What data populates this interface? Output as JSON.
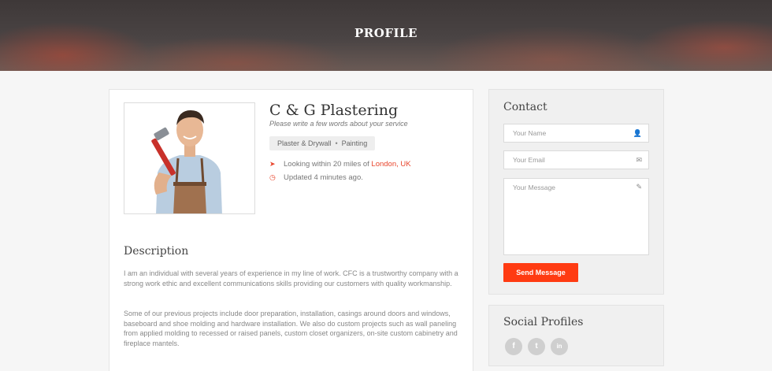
{
  "header": {
    "title": "PROFILE"
  },
  "profile": {
    "name": "C & G Plastering",
    "tagline": "Please write a few words about your service",
    "tags": [
      "Plaster & Drywall",
      "Painting"
    ],
    "location_prefix": "Looking within 20 miles of ",
    "location_link": "London, UK",
    "updated": "Updated 4 minutes ago."
  },
  "description": {
    "title": "Description",
    "paragraphs": [
      "I am an individual with several years of experience in my line of work. CFC is a trustworthy company with a strong work ethic and excellent communications skills providing our customers with quality workmanship.",
      "Some of our previous projects include door preparation, installation, casings around doors and windows, baseboard and shoe molding and hardware installation. We also do custom projects such as wall paneling from applied molding to recessed or raised panels, custom closet organizers, on-site custom cabinetry and fireplace mantels."
    ]
  },
  "contact": {
    "title": "Contact",
    "name_placeholder": "Your Name",
    "email_placeholder": "Your Email",
    "message_placeholder": "Your Message",
    "send_label": "Send Message"
  },
  "social": {
    "title": "Social Profiles",
    "items": [
      {
        "icon": "facebook-icon",
        "glyph": "f"
      },
      {
        "icon": "twitter-icon",
        "glyph": "t"
      },
      {
        "icon": "linkedin-icon",
        "glyph": "in"
      }
    ]
  },
  "colors": {
    "accent": "#ff3b12",
    "link": "#e8452c"
  }
}
